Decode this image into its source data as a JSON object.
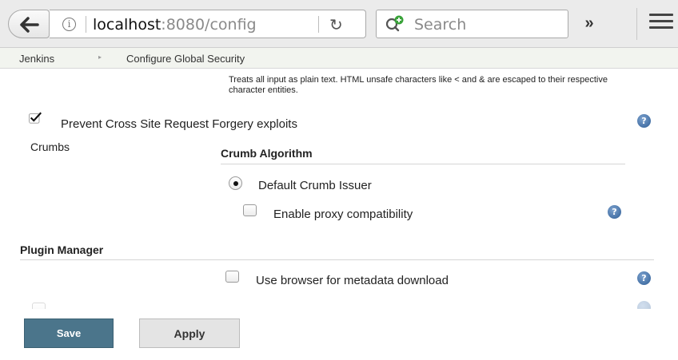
{
  "browser": {
    "url_host": "localhost",
    "url_rest": ":8080/config",
    "search_placeholder": "Search",
    "overflow_label": "»"
  },
  "breadcrumb": {
    "items": [
      "Jenkins",
      "Configure Global Security"
    ],
    "separator": "▸"
  },
  "content": {
    "markup_hint": "Treats all input as plain text. HTML unsafe characters like < and & are escaped to their respective character entities.",
    "csrf": {
      "label": "Prevent Cross Site Request Forgery exploits",
      "checked": true
    },
    "crumbs_label": "Crumbs",
    "crumb_algorithm": {
      "heading": "Crumb Algorithm",
      "option_label": "Default Crumb Issuer",
      "option_selected": true,
      "proxy_label": "Enable proxy compatibility",
      "proxy_checked": false
    },
    "plugin_manager": {
      "heading": "Plugin Manager",
      "browser_metadata_label": "Use browser for metadata download",
      "browser_metadata_checked": false
    },
    "help_glyph": "?"
  },
  "actions": {
    "save_label": "Save",
    "apply_label": "Apply"
  },
  "colors": {
    "save_button": "#4b758b",
    "help_icon": "#2e5d95",
    "breadcrumb_bg": "#f2f4ef"
  }
}
